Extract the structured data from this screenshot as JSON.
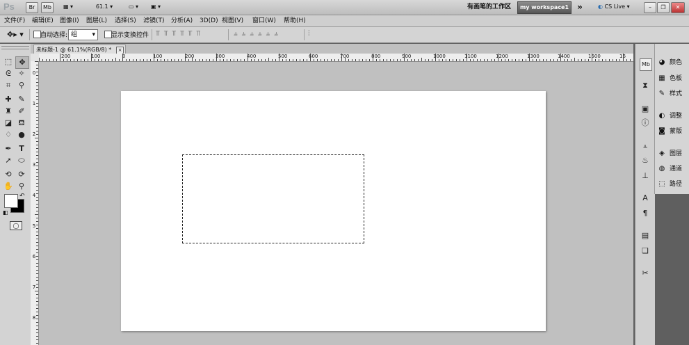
{
  "app": {
    "logo": "Ps",
    "zoom_level": "61.1",
    "workspace_label": "有画笔的工作区",
    "workspace_button": "my workspace1",
    "cs_live": "CS Live",
    "chevrons": "»",
    "br_label": "Br",
    "mb_label": "Mb"
  },
  "menu": [
    "文件(F)",
    "编辑(E)",
    "图像(I)",
    "图层(L)",
    "选择(S)",
    "滤镜(T)",
    "分析(A)",
    "3D(D)",
    "视图(V)",
    "窗口(W)",
    "帮助(H)"
  ],
  "options": {
    "auto_select_label": "自动选择:",
    "auto_select_value": "组",
    "show_transform_label": "显示变换控件"
  },
  "document": {
    "tab_title": "未标题-1 @ 61.1%(RGB/8) *",
    "close_glyph": "×"
  },
  "ruler": {
    "h_labels": [
      "200",
      "100",
      "0",
      "100",
      "200",
      "300",
      "400",
      "500",
      "600",
      "700",
      "800",
      "900",
      "1000",
      "1100",
      "1200",
      "1300",
      "1400",
      "1500",
      "16"
    ],
    "v_labels": [
      "0",
      "1",
      "2",
      "3",
      "4",
      "5",
      "6",
      "7",
      "8"
    ]
  },
  "panels": [
    {
      "label": "颜色",
      "icon": "color-icon"
    },
    {
      "label": "色板",
      "icon": "swatches-icon"
    },
    {
      "label": "样式",
      "icon": "styles-icon"
    },
    {
      "label": "调整",
      "icon": "adjustments-icon"
    },
    {
      "label": "蒙版",
      "icon": "masks-icon"
    },
    {
      "label": "图层",
      "icon": "layers-icon"
    },
    {
      "label": "通道",
      "icon": "channels-icon"
    },
    {
      "label": "路径",
      "icon": "paths-icon"
    }
  ],
  "colors": {
    "foreground": "#ffffff",
    "background": "#000000"
  }
}
